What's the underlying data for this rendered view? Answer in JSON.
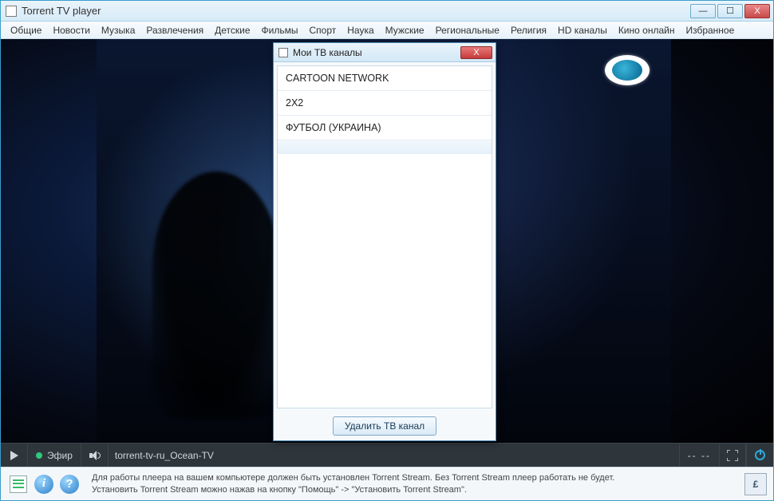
{
  "window": {
    "title": "Torrent TV player",
    "buttons": {
      "minimize": "—",
      "maximize": "☐",
      "close": "X"
    }
  },
  "menu": {
    "items": [
      "Общие",
      "Новости",
      "Музыка",
      "Развлечения",
      "Детские",
      "Фильмы",
      "Спорт",
      "Наука",
      "Мужские",
      "Региональные",
      "Религия",
      "HD каналы",
      "Кино онлайн",
      "Избранное"
    ]
  },
  "player": {
    "live_label": "Эфир",
    "stream_name": "torrent-tv-ru_Ocean-TV",
    "time": "-- --",
    "channel_logo_name": "ocean-tv-logo"
  },
  "dialog": {
    "title": "Мои ТВ каналы",
    "items": [
      "CARTOON NETWORK",
      "2X2",
      "ФУТБОЛ (УКРАИНА)"
    ],
    "selected_index": 3,
    "delete_button": "Удалить ТВ канал",
    "close": "X"
  },
  "status": {
    "line1": "Для работы плеера на вашем компьютере должен быть установлен Torrent Stream. Без Torrent Stream плеер работать не будет.",
    "line2": "Установить Torrent Stream можно нажав на кнопку \"Помощь\" -> \"Установить Torrent Stream\".",
    "info_glyph": "i",
    "help_glyph": "?",
    "currency_glyph": "£"
  }
}
